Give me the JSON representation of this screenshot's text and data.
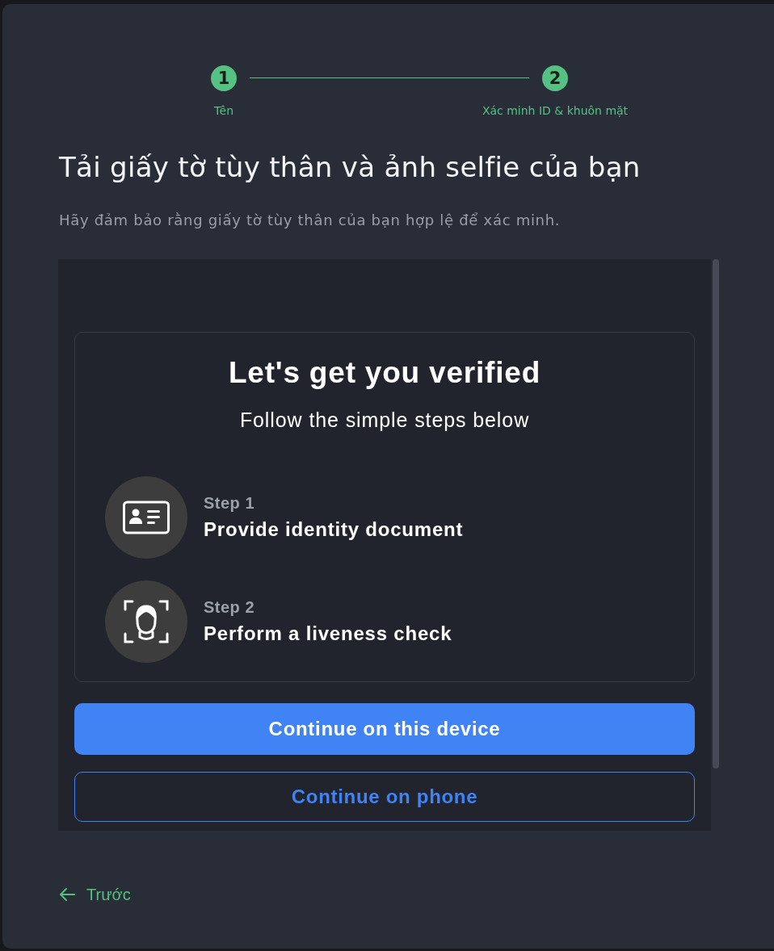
{
  "stepper": {
    "steps": [
      {
        "number": "1",
        "label": "Tên",
        "active": true
      },
      {
        "number": "2",
        "label": "Xác minh ID & khuôn mặt",
        "active": true
      }
    ]
  },
  "title": "Tải giấy tờ tùy thân và ảnh selfie của bạn",
  "subtitle": "Hãy đảm bảo rằng giấy tờ tùy thân của bạn hợp lệ để xác minh.",
  "verification": {
    "heading": "Let's get you verified",
    "subheading": "Follow the simple steps below",
    "steps": [
      {
        "kind": "document",
        "label": "Step 1",
        "text": "Provide identity document"
      },
      {
        "kind": "liveness",
        "label": "Step 2",
        "text": "Perform a liveness check"
      }
    ],
    "buttons": [
      {
        "kind": "primary",
        "label": "Continue on this device"
      },
      {
        "kind": "outline",
        "label": "Continue on phone"
      }
    ]
  },
  "back_link": {
    "label": "Trước"
  }
}
